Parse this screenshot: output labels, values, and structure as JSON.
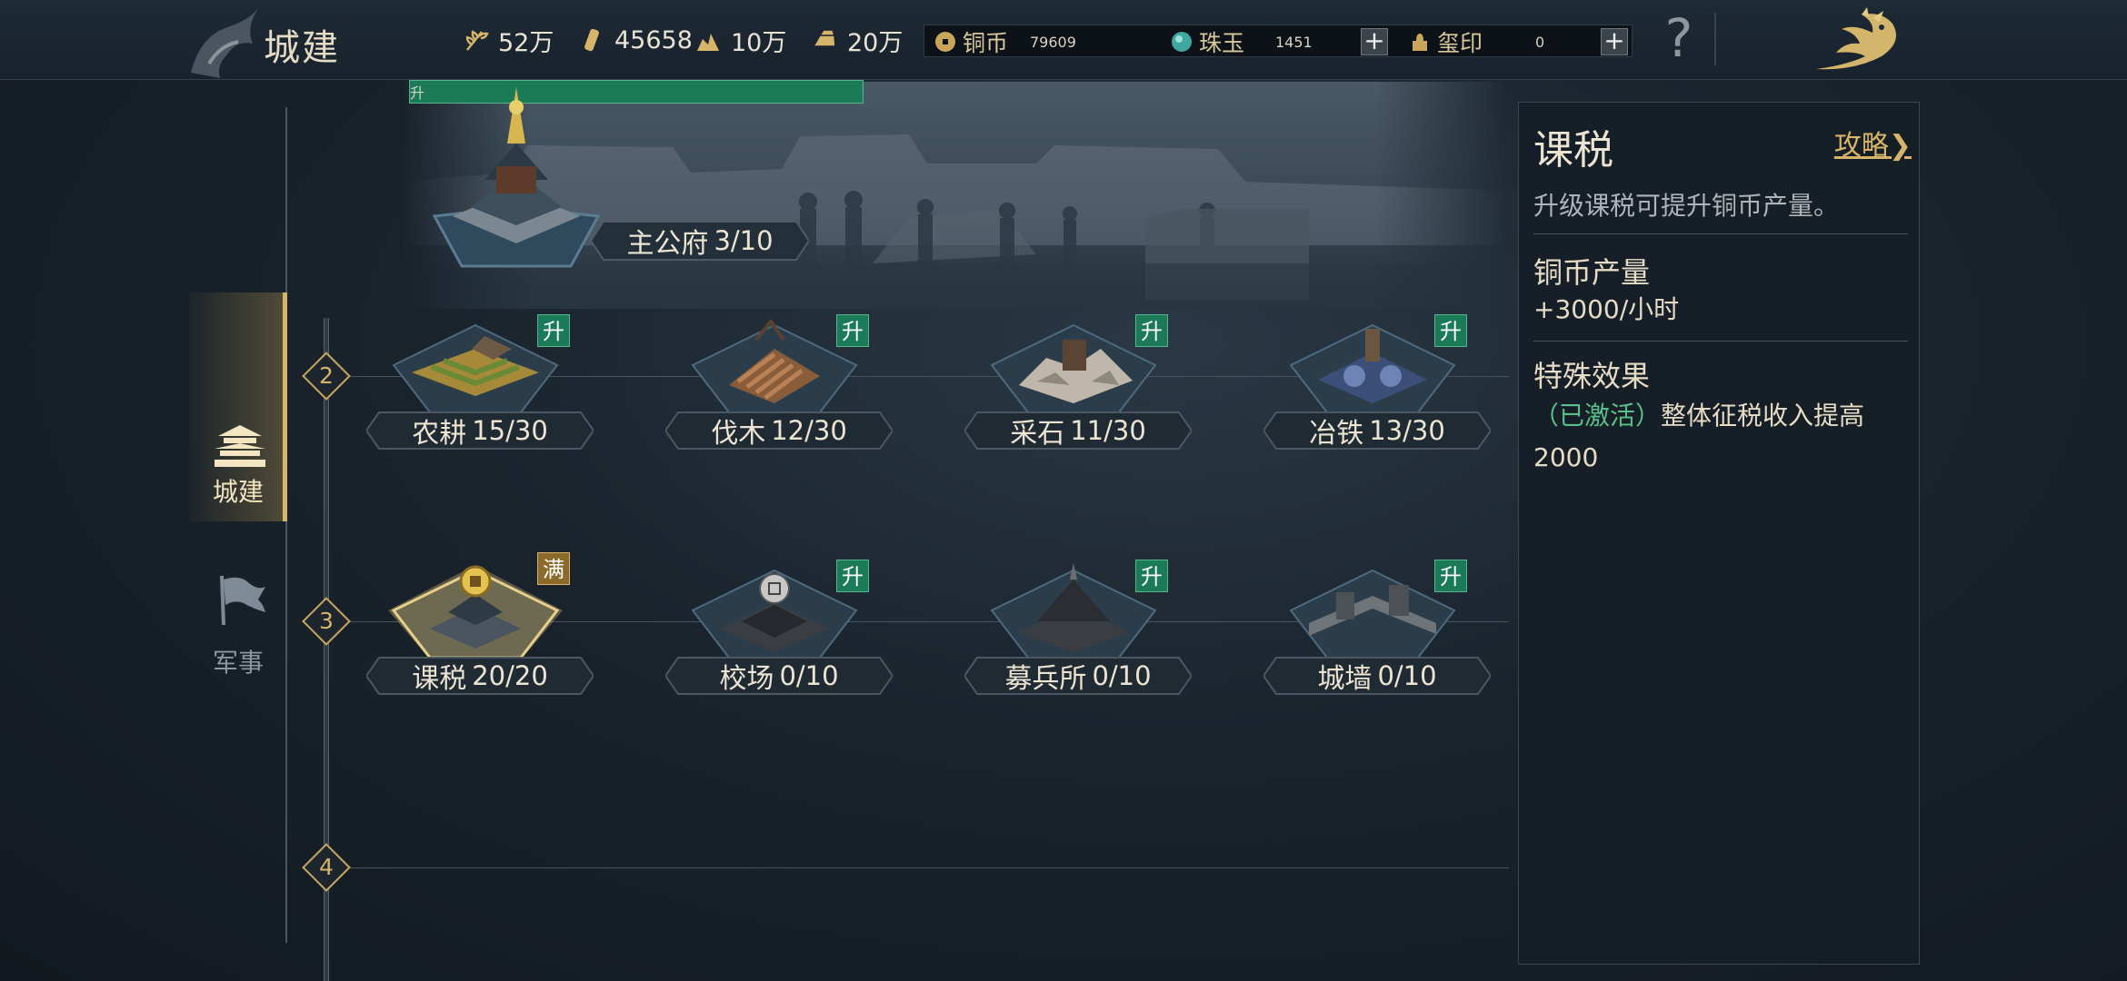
{
  "header": {
    "title": "城建",
    "resources": [
      {
        "icon": "grain-icon",
        "value": "52万"
      },
      {
        "icon": "wood-icon",
        "value": "45658"
      },
      {
        "icon": "stone-icon",
        "value": "10万"
      },
      {
        "icon": "iron-icon",
        "value": "20万"
      }
    ],
    "currencies": [
      {
        "icon": "copper-coin-icon",
        "label": "铜币",
        "value": "79609",
        "has_plus": false
      },
      {
        "icon": "jade-icon",
        "label": "珠玉",
        "value": "1451",
        "has_plus": true
      },
      {
        "icon": "seal-icon",
        "label": "玺印",
        "value": "0",
        "has_plus": true
      }
    ],
    "plus_glyph": "+",
    "help_glyph": "?"
  },
  "nav": {
    "items": [
      {
        "label": "城建",
        "icon": "city-building-icon",
        "active": true
      },
      {
        "label": "军事",
        "icon": "military-flag-icon",
        "active": false
      }
    ]
  },
  "main_building": {
    "name": "主公府",
    "level": "3/10",
    "badge": "升"
  },
  "tiers": [
    {
      "number": "2",
      "buildings": [
        {
          "name": "农耕",
          "level": "15/30",
          "badge": "升",
          "badge_type": "upgrade",
          "art": "farm"
        },
        {
          "name": "伐木",
          "level": "12/30",
          "badge": "升",
          "badge_type": "upgrade",
          "art": "lumber"
        },
        {
          "name": "采石",
          "level": "11/30",
          "badge": "升",
          "badge_type": "upgrade",
          "art": "quarry"
        },
        {
          "name": "冶铁",
          "level": "13/30",
          "badge": "升",
          "badge_type": "upgrade",
          "art": "smelt"
        }
      ]
    },
    {
      "number": "3",
      "buildings": [
        {
          "name": "课税",
          "level": "20/20",
          "badge": "满",
          "badge_type": "max",
          "art": "tax"
        },
        {
          "name": "校场",
          "level": "0/10",
          "badge": "升",
          "badge_type": "upgrade",
          "art": "training"
        },
        {
          "name": "募兵所",
          "level": "0/10",
          "badge": "升",
          "badge_type": "upgrade",
          "art": "recruit"
        },
        {
          "name": "城墙",
          "level": "0/10",
          "badge": "升",
          "badge_type": "upgrade",
          "art": "wall"
        }
      ]
    },
    {
      "number": "4",
      "buildings": []
    }
  ],
  "info_panel": {
    "title": "课税",
    "guide_label": "攻略",
    "guide_chevron": "❯",
    "description": "升级课税可提升铜币产量。",
    "production_label": "铜币产量",
    "production_value": "+3000/小时",
    "effect_label": "特殊效果",
    "effect_status": "（已激活）",
    "effect_text": "整体征税收入提高2000"
  },
  "colors": {
    "gold_accent": "#d6b56a",
    "upgrade_badge": "#1b7a57",
    "max_badge": "#8b6a2a",
    "active_status": "#58c08a"
  }
}
